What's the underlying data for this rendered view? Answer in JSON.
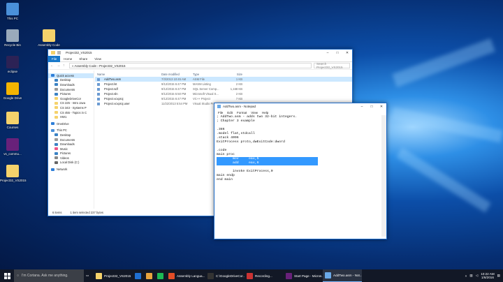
{
  "desktop": {
    "icons": [
      {
        "label": "This PC",
        "color": "#4a90d9"
      },
      {
        "label": "Recycle Bin",
        "color": "#9ab"
      },
      {
        "label": "eclipse",
        "color": "#2c2255"
      },
      {
        "label": "Google Drive",
        "color": "#f4b400"
      },
      {
        "label": "Courses",
        "color": "#f5d26b"
      },
      {
        "label": "vs_commu...",
        "color": "#68217a"
      },
      {
        "label": "Project32_VS2015",
        "color": "#f5d26b"
      },
      {
        "label": "Assembly Code",
        "color": "#f5d26b"
      }
    ]
  },
  "explorer": {
    "title": "Project32_VS2015",
    "ribbon": [
      "File",
      "Home",
      "Share",
      "View"
    ],
    "address_path": "« Assembly Code › Project32_VS2015",
    "search_placeholder": "Search Project32_VS2015",
    "nav_items": [
      "Quick access",
      "Desktop",
      "Downloads",
      "Documents",
      "Pictures",
      "GoogleDriveCor",
      "CS 225 - Intro Java",
      "CS 343 - Systems P",
      "CS 455 - Topics in C",
      "HW1",
      "OneDrive",
      "This PC",
      "Desktop",
      "Documents",
      "Downloads",
      "Music",
      "Pictures",
      "Videos",
      "Local Disk (C:)",
      "Network"
    ],
    "columns": [
      "Name",
      "Date modified",
      "Type",
      "Size"
    ],
    "files": [
      {
        "name": "AddTwo.asm",
        "date": "7/3/2013 10:45 AM",
        "type": "ASM File",
        "size": "1 KB"
      },
      {
        "name": "Project.lst",
        "date": "9/12/2015 6:47 PM",
        "type": "MASM Listing",
        "size": "2 KB"
      },
      {
        "name": "Project.sdf",
        "date": "9/12/2015 6:47 PM",
        "type": "SQL Server Comp...",
        "size": "1,168 KB"
      },
      {
        "name": "Project.sln",
        "date": "9/12/2015 5:50 PM",
        "type": "Microsoft Visual S...",
        "size": "2 KB"
      },
      {
        "name": "Project.vcxproj",
        "date": "9/12/2015 6:47 PM",
        "type": "VC++ Project",
        "size": "7 KB"
      },
      {
        "name": "Project.vcxproj.user",
        "date": "11/22/2013 5:54 PM",
        "type": "Visual Studio Pr...",
        "size": "1 KB"
      }
    ],
    "status_count": "6 items",
    "status_selected": "1 item selected  237 bytes"
  },
  "notepad": {
    "title": "AddTwo.asm - Notepad",
    "menu": [
      "File",
      "Edit",
      "Format",
      "View",
      "Help"
    ],
    "lines": [
      "; AddTwo.asm - adds two 32-bit integers.",
      "; Chapter 3 example",
      "",
      ".386",
      ".model flat,stdcall",
      ".stack 4096",
      "ExitProcess proto,dwExitCode:dword",
      "",
      ".code",
      "main proc",
      "        mov     eax,5",
      "        add     eax,6",
      "",
      "        invoke ExitProcess,0",
      "main endp",
      "end main"
    ]
  },
  "taskbar": {
    "cortana": "I'm Cortana. Ask me anything.",
    "apps": [
      {
        "label": "Project32_VS2015",
        "color": "#f5d26b"
      },
      {
        "label": "",
        "color": "#1f6fd1"
      },
      {
        "label": "",
        "color": "#e8a33d"
      },
      {
        "label": "",
        "color": "#1db954"
      },
      {
        "label": "Assembly Langua...",
        "color": "#e44d26"
      },
      {
        "label": "C:\\GoogleDriveCor...",
        "color": "#333"
      },
      {
        "label": "Recording...",
        "color": "#c33"
      },
      {
        "label": "Start Page - Micros...",
        "color": "#68217a"
      },
      {
        "label": "AddTwo.asm - Not...",
        "color": "#6aa9e8"
      }
    ],
    "time": "10:22 AM",
    "date": "1/6/2016"
  }
}
